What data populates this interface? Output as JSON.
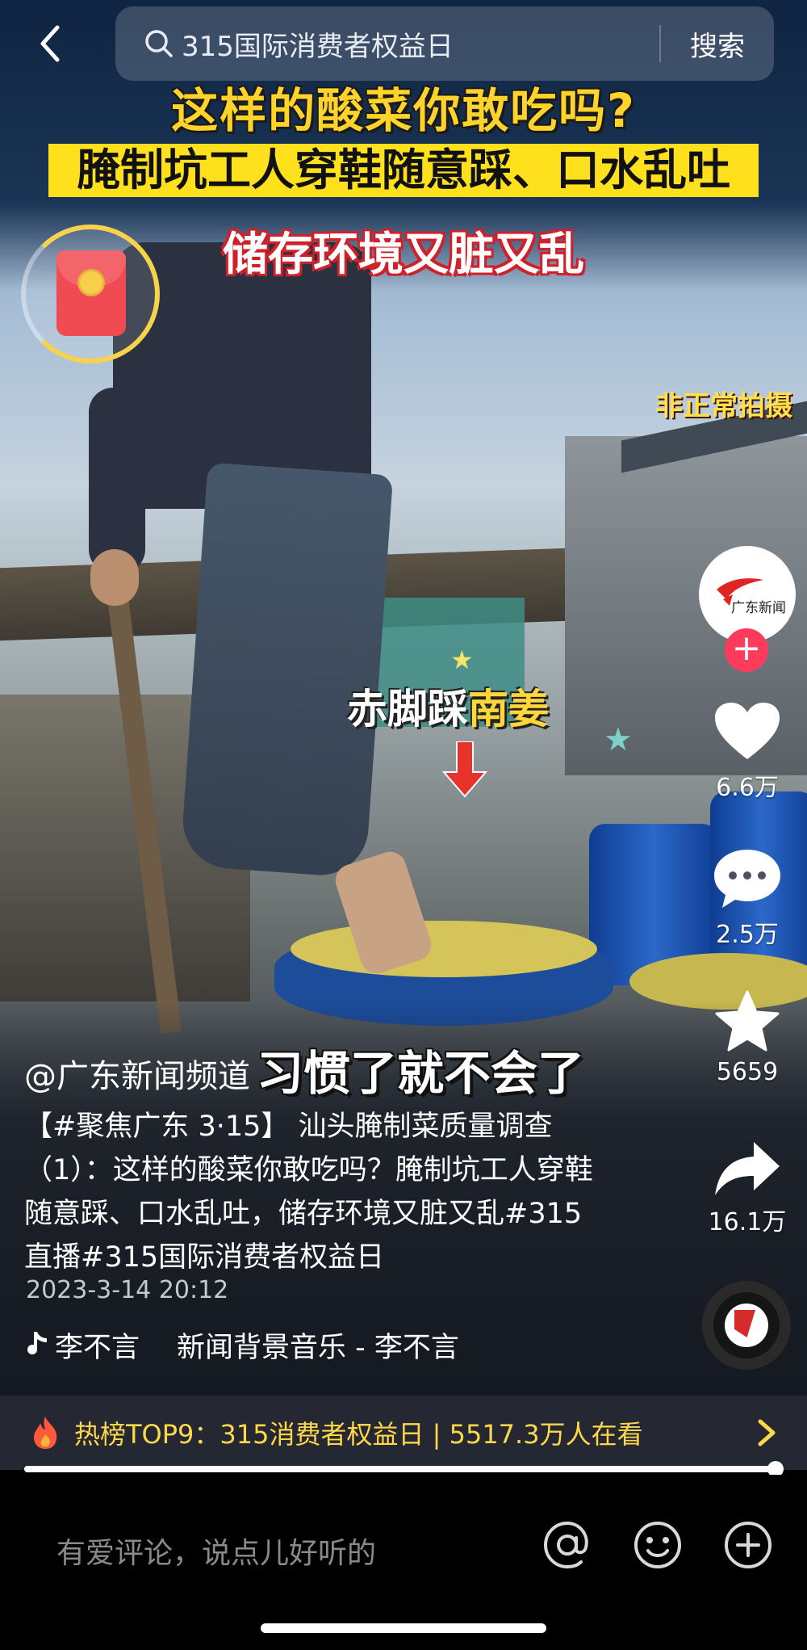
{
  "search": {
    "query": "315国际消费者权益日",
    "button": "搜索"
  },
  "overlay": {
    "title_line1": "这样的酸菜你敢吃吗?",
    "title_line2": "腌制坑工人穿鞋随意踩、口水乱吐",
    "title_line3": "储存环境又脏又乱",
    "corner_note": "非正常拍摄",
    "scene_label_white": "赤脚踩",
    "scene_label_yellow": "南姜",
    "subtitle": "习惯了就不会了"
  },
  "actions": {
    "follow_symbol": "+",
    "avatar_text": "广东新闻",
    "likes": "6.6万",
    "comments": "2.5万",
    "favorites": "5659",
    "shares": "16.1万"
  },
  "post": {
    "author": "@广东新闻频道",
    "description": "【#聚焦广东 3·15】 汕头腌制菜质量调查（1）：这样的酸菜你敢吃吗？腌制坑工人穿鞋随意踩、口水乱吐，储存环境又脏又乱#315直播#315国际消费者权益日",
    "date": "2023-3-14 20:12",
    "music_artist": "李不言",
    "music_title": "新闻背景音乐 - 李不言"
  },
  "hot": {
    "text": "热榜TOP9：315消费者权益日 | 5517.3万人在看"
  },
  "playback": {
    "progress": 0.99
  },
  "comment_bar": {
    "placeholder": "有爱评论，说点儿好听的"
  },
  "colors": {
    "accent_yellow": "#ffd84a",
    "follow_red": "#ff3b5c"
  }
}
